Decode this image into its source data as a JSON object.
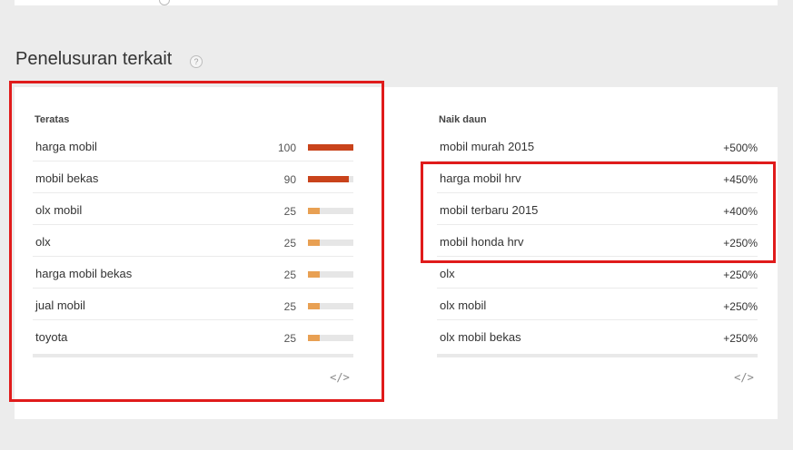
{
  "section": {
    "title": "Penelusuran terkait",
    "help": "?"
  },
  "top": {
    "title": "Teratas",
    "rows": [
      {
        "label": "harga mobil",
        "value": "100",
        "level": 100
      },
      {
        "label": "mobil bekas",
        "value": "90",
        "level": 90
      },
      {
        "label": "olx mobil",
        "value": "25",
        "level": 25
      },
      {
        "label": "olx",
        "value": "25",
        "level": 25
      },
      {
        "label": "harga mobil bekas",
        "value": "25",
        "level": 25
      },
      {
        "label": "jual mobil",
        "value": "25",
        "level": 25
      },
      {
        "label": "toyota",
        "value": "25",
        "level": 25
      }
    ],
    "embed_icon": "code-icon"
  },
  "rising": {
    "title": "Naik daun",
    "rows": [
      {
        "label": "mobil murah 2015",
        "value": "+500%"
      },
      {
        "label": "harga mobil hrv",
        "value": "+450%"
      },
      {
        "label": "mobil terbaru 2015",
        "value": "+400%"
      },
      {
        "label": "mobil honda hrv",
        "value": "+250%"
      },
      {
        "label": "olx",
        "value": "+250%"
      },
      {
        "label": "olx mobil",
        "value": "+250%"
      },
      {
        "label": "olx mobil bekas",
        "value": "+250%"
      }
    ],
    "embed_icon": "code-icon"
  },
  "colors": {
    "bar_high": "#c9431b",
    "bar_low": "#e8a053",
    "track": "#e6e6e6",
    "highlight": "#e01b1b"
  }
}
